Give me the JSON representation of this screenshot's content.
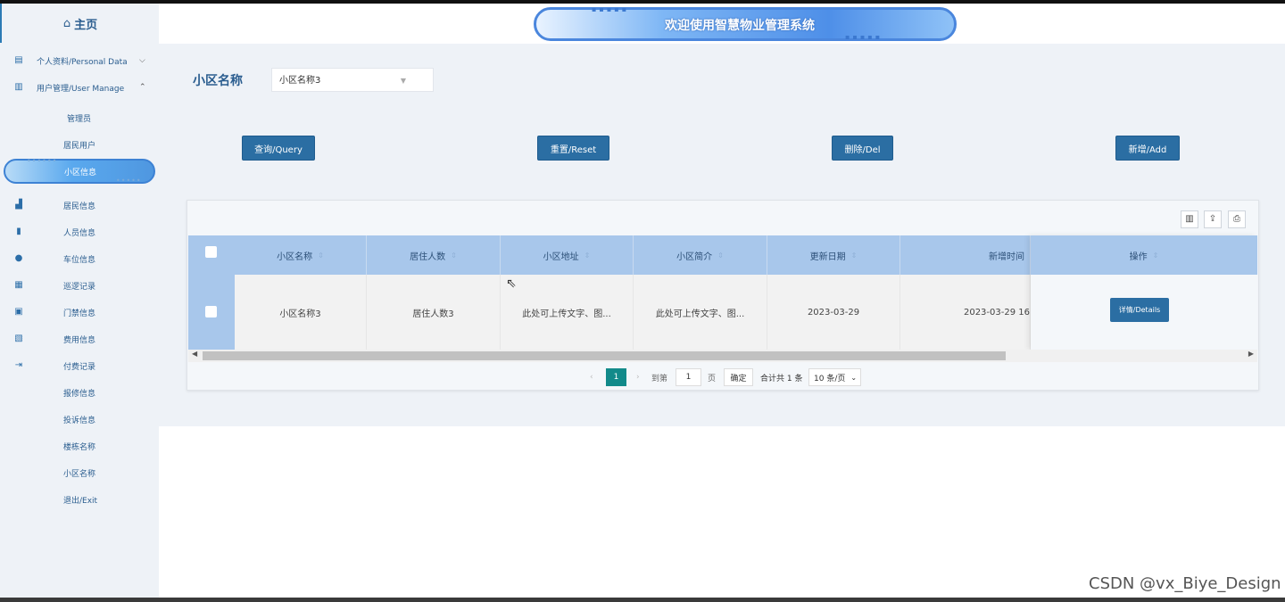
{
  "sidebar": {
    "home_label": "主页",
    "groups": [
      {
        "label": "个人资料/Personal Data",
        "chevron": "⌵"
      },
      {
        "label": "用户管理/User Manage",
        "chevron": "⌃"
      }
    ],
    "sub_items": [
      "管理员",
      "居民用户"
    ],
    "active_item": "小区信息",
    "items": [
      "居民信息",
      "人员信息",
      "车位信息",
      "巡逻记录",
      "门禁信息",
      "费用信息",
      "付费记录",
      "报修信息",
      "投诉信息",
      "楼栋名称",
      "小区名称",
      "退出/Exit"
    ],
    "icons": [
      "document-icon",
      "clipboard-icon",
      "bar-chart-icon",
      "bookmark-icon",
      "user-pin-icon",
      "calendar-icon",
      "calendar-check-icon",
      "book-icon",
      "logout-icon"
    ]
  },
  "header": {
    "title": "欢迎使用智慧物业管理系统"
  },
  "filter": {
    "label": "小区名称",
    "select_value": "小区名称3"
  },
  "actions": {
    "query": "查询/Query",
    "reset": "重置/Reset",
    "delete": "删除/Del",
    "add": "新增/Add"
  },
  "table": {
    "columns": [
      "小区名称",
      "居住人数",
      "小区地址",
      "小区简介",
      "更新日期",
      "新增时间",
      "操作"
    ],
    "rows": [
      {
        "name": "小区名称3",
        "residents": "居住人数3",
        "address": "此处可上传文字、图...",
        "intro": "此处可上传文字、图...",
        "updated": "2023-03-29",
        "created": "2023-03-29 16",
        "details_label": "详情/Details"
      }
    ]
  },
  "pagination": {
    "current_page": "1",
    "goto_label": "到第",
    "goto_value": "1",
    "page_unit": "页",
    "confirm": "确定",
    "total": "合计共 1 条",
    "page_size": "10 条/页"
  },
  "watermark": "CSDN @vx_Biye_Design",
  "colors": {
    "primary": "#2b6ea3",
    "header_row": "#a8c7eb",
    "background": "#eef2f7",
    "pager_active": "#128a8a"
  }
}
